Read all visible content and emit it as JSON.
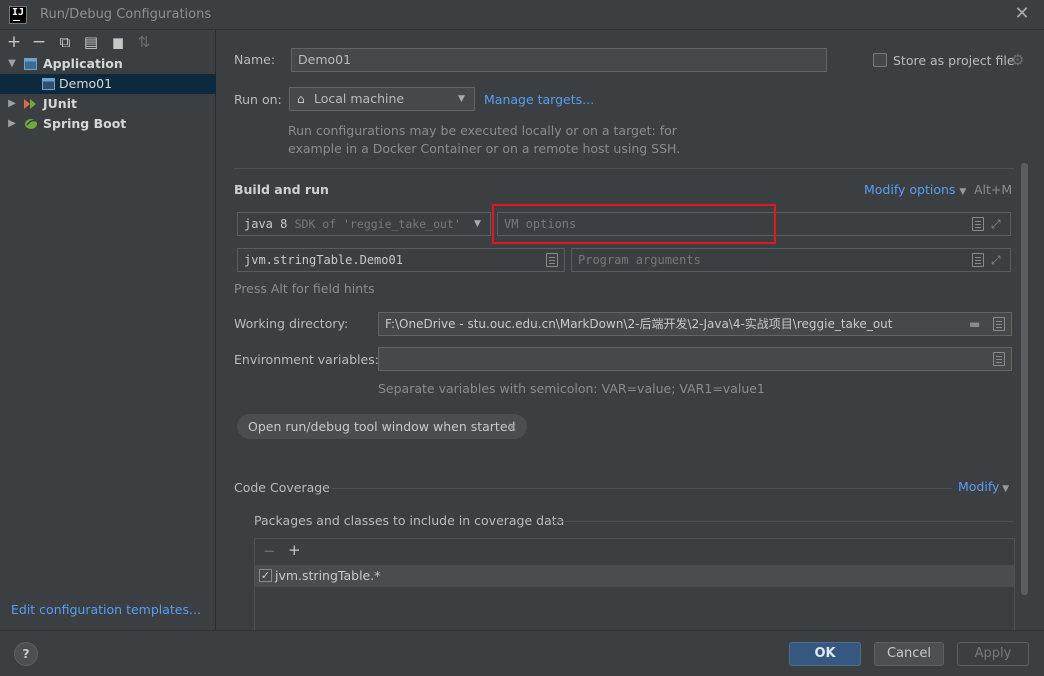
{
  "window": {
    "title": "Run/Debug Configurations",
    "app_icon_text": "IJ",
    "close_glyph": "✕"
  },
  "toolbar": {
    "icons": [
      {
        "name": "add-icon",
        "glyph": "+"
      },
      {
        "name": "remove-icon",
        "glyph": "−"
      },
      {
        "name": "copy-icon",
        "glyph": "⧉"
      },
      {
        "name": "save-icon",
        "glyph": "▤"
      },
      {
        "name": "new-folder-icon",
        "glyph": "▆"
      },
      {
        "name": "sort-icon",
        "glyph": "⇅"
      }
    ]
  },
  "tree": {
    "items": [
      {
        "label": "Application",
        "expanded": true
      },
      {
        "label": "Demo01",
        "selected": true
      },
      {
        "label": "JUnit",
        "expanded": false
      },
      {
        "label": "Spring Boot",
        "expanded": false
      }
    ],
    "expanded_glyph": "▼",
    "collapsed_glyph": "▶"
  },
  "left_footer": {
    "edit_templates": "Edit configuration templates..."
  },
  "form": {
    "name_label": "Name:",
    "name_value": "Demo01",
    "store_as_project": "Store as project file",
    "run_on_label": "Run on:",
    "run_on_value": "Local machine",
    "manage_targets": "Manage targets...",
    "run_on_hint_1": "Run configurations may be executed locally or on a target: for",
    "run_on_hint_2": "example in a Docker Container or on a remote host using SSH.",
    "build_and_run": "Build and run",
    "modify_options": "Modify options",
    "modify_shortcut": "Alt+M",
    "jdk_value_bold": "java 8",
    "jdk_value_rest": "SDK of 'reggie_take_out'",
    "vm_options_placeholder": "VM options",
    "main_class_value": "jvm.stringTable.Demo01",
    "program_args_placeholder": "Program arguments",
    "field_hints": "Press Alt for field hints",
    "working_dir_label": "Working directory:",
    "working_dir_value": "F:\\OneDrive - stu.ouc.edu.cn\\MarkDown\\2-后端开发\\2-Java\\4-实战项目\\reggie_take_out",
    "env_label": "Environment variables:",
    "env_value": "",
    "env_hint": "Separate variables with semicolon: VAR=value; VAR1=value1",
    "open_tool_window_chip": "Open run/debug tool window when started",
    "chip_close": "×",
    "code_coverage": "Code Coverage",
    "modify": "Modify",
    "packages_label": "Packages and classes to include in coverage data",
    "coverage_items": [
      {
        "label": "jvm.stringTable.*",
        "checked": true
      }
    ]
  },
  "buttons": {
    "help": "?",
    "ok": "OK",
    "cancel": "Cancel",
    "apply": "Apply"
  },
  "colors": {
    "accent_link": "#589df6",
    "highlight_box": "#e2161b",
    "selection": "#0d293e",
    "ok_button": "#365880"
  }
}
